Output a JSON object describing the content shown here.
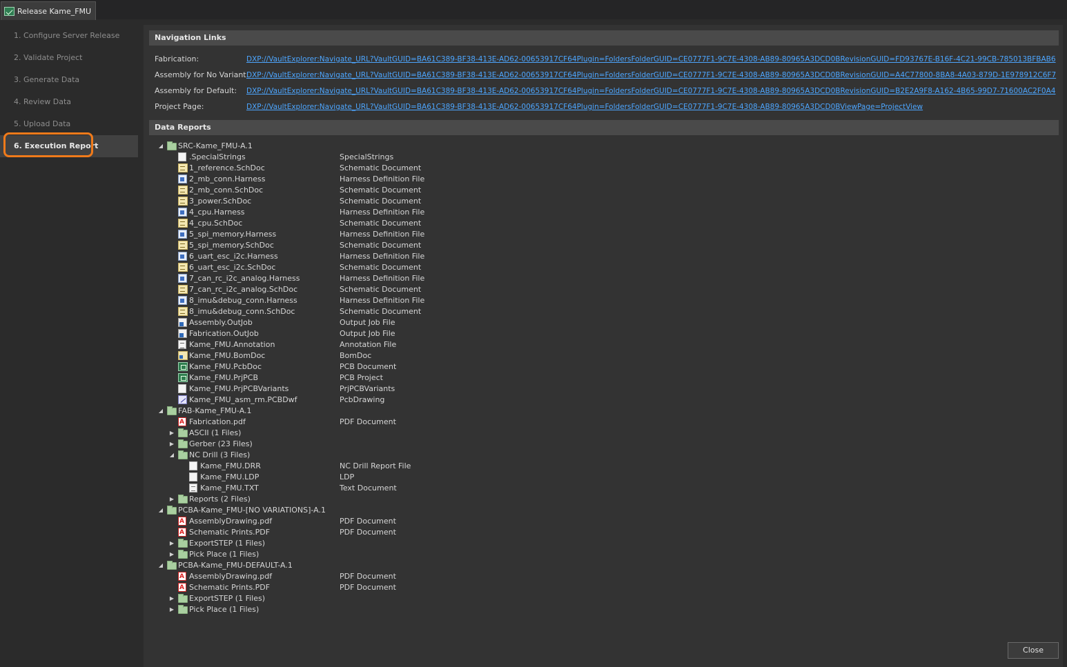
{
  "window": {
    "tab_title": "Release Kame_FMU"
  },
  "steps": [
    {
      "label": "1. Configure Server Release"
    },
    {
      "label": "2. Validate Project"
    },
    {
      "label": "3. Generate Data"
    },
    {
      "label": "4. Review Data"
    },
    {
      "label": "5. Upload Data"
    },
    {
      "label": "6. Execution Report"
    }
  ],
  "navigation": {
    "header": "Navigation Links",
    "rows": [
      {
        "label": "Fabrication:",
        "url": "DXP://VaultExplorer:Navigate_URL?VaultGUID=BA61C389-BF38-413E-AD62-00653917CF64Plugin=FoldersFolderGUID=CE0777F1-9C7E-4308-AB89-80965A3DCD0BRevisionGUID=FD93767E-B16F-4C21-99CB-785013BFBAB6"
      },
      {
        "label": "Assembly for No Variant:",
        "url": "DXP://VaultExplorer:Navigate_URL?VaultGUID=BA61C389-BF38-413E-AD62-00653917CF64Plugin=FoldersFolderGUID=CE0777F1-9C7E-4308-AB89-80965A3DCD0BRevisionGUID=A4C77800-8BA8-4A03-879D-1E978912C6F7"
      },
      {
        "label": "Assembly for Default:",
        "url": "DXP://VaultExplorer:Navigate_URL?VaultGUID=BA61C389-BF38-413E-AD62-00653917CF64Plugin=FoldersFolderGUID=CE0777F1-9C7E-4308-AB89-80965A3DCD0BRevisionGUID=B2E2A9F8-A162-4B65-99D7-71600AC2F0A4"
      },
      {
        "label": "Project Page:",
        "url": "DXP://VaultExplorer:Navigate_URL?VaultGUID=BA61C389-BF38-413E-AD62-00653917CF64Plugin=FoldersFolderGUID=CE0777F1-9C7E-4308-AB89-80965A3DCD0BViewPage=ProjectView"
      }
    ]
  },
  "reports": {
    "header": "Data Reports",
    "tree": [
      {
        "level": 0,
        "exp": "open",
        "icon": "folder-green",
        "name": "SRC-Kame_FMU-A.1",
        "type": ""
      },
      {
        "level": 1,
        "icon": "file",
        "name": ".SpecialStrings",
        "type": "SpecialStrings"
      },
      {
        "level": 1,
        "icon": "sch",
        "name": "1_reference.SchDoc",
        "type": "Schematic Document"
      },
      {
        "level": 1,
        "icon": "harness",
        "name": "2_mb_conn.Harness",
        "type": "Harness Definition File"
      },
      {
        "level": 1,
        "icon": "sch",
        "name": "2_mb_conn.SchDoc",
        "type": "Schematic Document"
      },
      {
        "level": 1,
        "icon": "sch",
        "name": "3_power.SchDoc",
        "type": "Schematic Document"
      },
      {
        "level": 1,
        "icon": "harness",
        "name": "4_cpu.Harness",
        "type": "Harness Definition File"
      },
      {
        "level": 1,
        "icon": "sch",
        "name": "4_cpu.SchDoc",
        "type": "Schematic Document"
      },
      {
        "level": 1,
        "icon": "harness",
        "name": "5_spi_memory.Harness",
        "type": "Harness Definition File"
      },
      {
        "level": 1,
        "icon": "sch",
        "name": "5_spi_memory.SchDoc",
        "type": "Schematic Document"
      },
      {
        "level": 1,
        "icon": "harness",
        "name": "6_uart_esc_i2c.Harness",
        "type": "Harness Definition File"
      },
      {
        "level": 1,
        "icon": "sch",
        "name": "6_uart_esc_i2c.SchDoc",
        "type": "Schematic Document"
      },
      {
        "level": 1,
        "icon": "harness",
        "name": "7_can_rc_i2c_analog.Harness",
        "type": "Harness Definition File"
      },
      {
        "level": 1,
        "icon": "sch",
        "name": "7_can_rc_i2c_analog.SchDoc",
        "type": "Schematic Document"
      },
      {
        "level": 1,
        "icon": "harness",
        "name": "8_imu&debug_conn.Harness",
        "type": "Harness Definition File"
      },
      {
        "level": 1,
        "icon": "sch",
        "name": "8_imu&debug_conn.SchDoc",
        "type": "Schematic Document"
      },
      {
        "level": 1,
        "icon": "outjob",
        "name": "Assembly.OutJob",
        "type": "Output Job File"
      },
      {
        "level": 1,
        "icon": "outjob",
        "name": "Fabrication.OutJob",
        "type": "Output Job File"
      },
      {
        "level": 1,
        "icon": "annot",
        "name": "Kame_FMU.Annotation",
        "type": "Annotation File"
      },
      {
        "level": 1,
        "icon": "bom",
        "name": "Kame_FMU.BomDoc",
        "type": "BomDoc"
      },
      {
        "level": 1,
        "icon": "pcb",
        "name": "Kame_FMU.PcbDoc",
        "type": "PCB Document"
      },
      {
        "level": 1,
        "icon": "pcb",
        "name": "Kame_FMU.PrjPCB",
        "type": "PCB Project"
      },
      {
        "level": 1,
        "icon": "file",
        "name": "Kame_FMU.PrjPCBVariants",
        "type": "PrjPCBVariants"
      },
      {
        "level": 1,
        "icon": "dwf",
        "name": "Kame_FMU_asm_rm.PCBDwf",
        "type": " PcbDrawing"
      },
      {
        "level": 0,
        "exp": "open",
        "icon": "folder-green",
        "name": "FAB-Kame_FMU-A.1",
        "type": ""
      },
      {
        "level": 1,
        "icon": "pdf",
        "name": "Fabrication.pdf",
        "type": "PDF Document"
      },
      {
        "level": 1,
        "exp": "closed",
        "icon": "folder-green",
        "name": "ASCII (1 Files)",
        "type": ""
      },
      {
        "level": 1,
        "exp": "closed",
        "icon": "folder-green",
        "name": "Gerber (23 Files)",
        "type": ""
      },
      {
        "level": 1,
        "exp": "open",
        "icon": "folder-green",
        "name": "NC Drill (3 Files)",
        "type": ""
      },
      {
        "level": 2,
        "icon": "file",
        "name": "Kame_FMU.DRR",
        "type": "NC Drill Report File"
      },
      {
        "level": 2,
        "icon": "file",
        "name": "Kame_FMU.LDP",
        "type": "LDP"
      },
      {
        "level": 2,
        "icon": "txt",
        "name": "Kame_FMU.TXT",
        "type": "Text Document"
      },
      {
        "level": 1,
        "exp": "closed",
        "icon": "folder-green",
        "name": "Reports (2 Files)",
        "type": ""
      },
      {
        "level": 0,
        "exp": "open",
        "icon": "folder-green",
        "name": "PCBA-Kame_FMU-[NO VARIATIONS]-A.1",
        "type": ""
      },
      {
        "level": 1,
        "icon": "pdf",
        "name": "AssemblyDrawing.pdf",
        "type": "PDF Document"
      },
      {
        "level": 1,
        "icon": "pdf",
        "name": "Schematic Prints.PDF",
        "type": "PDF Document"
      },
      {
        "level": 1,
        "exp": "closed",
        "icon": "folder-green",
        "name": "ExportSTEP (1 Files)",
        "type": ""
      },
      {
        "level": 1,
        "exp": "closed",
        "icon": "folder-green",
        "name": "Pick Place (1 Files)",
        "type": ""
      },
      {
        "level": 0,
        "exp": "open",
        "icon": "folder-green",
        "name": "PCBA-Kame_FMU-DEFAULT-A.1",
        "type": ""
      },
      {
        "level": 1,
        "icon": "pdf",
        "name": "AssemblyDrawing.pdf",
        "type": "PDF Document"
      },
      {
        "level": 1,
        "icon": "pdf",
        "name": "Schematic Prints.PDF",
        "type": "PDF Document"
      },
      {
        "level": 1,
        "exp": "closed",
        "icon": "folder-green",
        "name": "ExportSTEP (1 Files)",
        "type": ""
      },
      {
        "level": 1,
        "exp": "closed",
        "icon": "folder-green",
        "name": "Pick Place (1 Files)",
        "type": ""
      }
    ]
  },
  "footer": {
    "close_label": "Close"
  },
  "colors": {
    "highlight": "#f07a1a",
    "link": "#4da6ff",
    "background": "#2b2b2b",
    "panel": "#333333",
    "header": "#4a4a4a"
  }
}
